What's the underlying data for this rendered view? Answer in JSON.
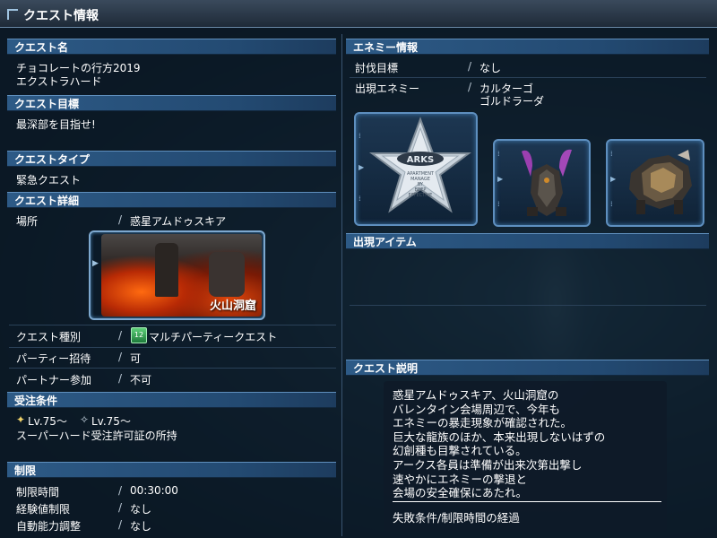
{
  "window": {
    "title": "クエスト情報"
  },
  "left": {
    "quest_name_header": "クエスト名",
    "quest_name": [
      "チョコレートの行方2019",
      "エクストラハード"
    ],
    "objective_header": "クエスト目標",
    "objective": "最深部を目指せ!",
    "type_header": "クエストタイプ",
    "type": "緊急クエスト",
    "details_header": "クエスト詳細",
    "rows": [
      {
        "label": "場所",
        "value": "惑星アムドゥスキア"
      }
    ],
    "location_caption": "火山洞窟",
    "quest_kind_label": "クエスト種別",
    "quest_kind_badge": "12",
    "quest_kind_value": "マルチパーティークエスト",
    "party_invite_label": "パーティー招待",
    "party_invite_value": "可",
    "partner_label": "パートナー参加",
    "partner_value": "不可",
    "requirements_header": "受注条件",
    "req_lv_main": "Lv.75～",
    "req_lv_sub": "Lv.75～",
    "req_license": "スーパーハード受注許可証の所持",
    "limits_header": "制限",
    "limits": [
      {
        "label": "制限時間",
        "value": "00:30:00"
      },
      {
        "label": "経験値制限",
        "value": "なし"
      },
      {
        "label": "自動能力調整",
        "value": "なし"
      }
    ],
    "separator": "/"
  },
  "right": {
    "enemy_header": "エネミー情報",
    "subjugation_label": "討伐目標",
    "subjugation_value": "なし",
    "appear_label": "出現エネミー",
    "appear_values": [
      "カルターゴ",
      "ゴルドラーダ"
    ],
    "emblem_text": [
      "ARKS",
      "APARTMENT",
      "MANAGE",
      "BY",
      "BEEP",
      "EFFECTIVE"
    ],
    "items_header": "出現アイテム",
    "desc_header": "クエスト説明",
    "description": "惑星アムドゥスキア、火山洞窟の\nバレンタイン会場周辺で、今年も\nエネミーの暴走現象が確認された。\n巨大な龍族のほか、本来出現しないはずの\n幻創種も目撃されている。\nアークス各員は準備が出来次第出撃し\n速やかにエネミーの撃退と\n会場の安全確保にあたれ。",
    "fail_condition": "失敗条件/制限時間の経過"
  },
  "colors": {
    "header": "#2d5a86",
    "frame": "#7da8cf"
  }
}
